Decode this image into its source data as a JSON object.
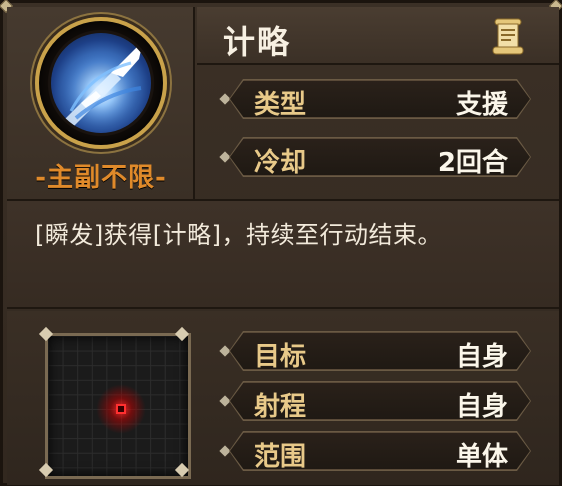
{
  "emblem": {
    "tag": "-主副不限-",
    "icon": "blue-spear-skill-icon"
  },
  "header": {
    "skill_name": "计略",
    "icon": "scroll-icon"
  },
  "attributes_top": [
    {
      "label": "类型",
      "value": "支援"
    },
    {
      "label": "冷却",
      "value": "2回合"
    }
  ],
  "description": "[瞬发]获得[计略]，持续至行动结束。",
  "range_grid": {
    "icon": "range-grid",
    "highlight": "center-cell"
  },
  "attributes_bottom": [
    {
      "label": "目标",
      "value": "自身"
    },
    {
      "label": "射程",
      "value": "自身"
    },
    {
      "label": "范围",
      "value": "单体"
    }
  ],
  "colors": {
    "tag_orange": "#e08a2a",
    "label_gold": "#e8c989",
    "target_red": "#ff3030"
  }
}
